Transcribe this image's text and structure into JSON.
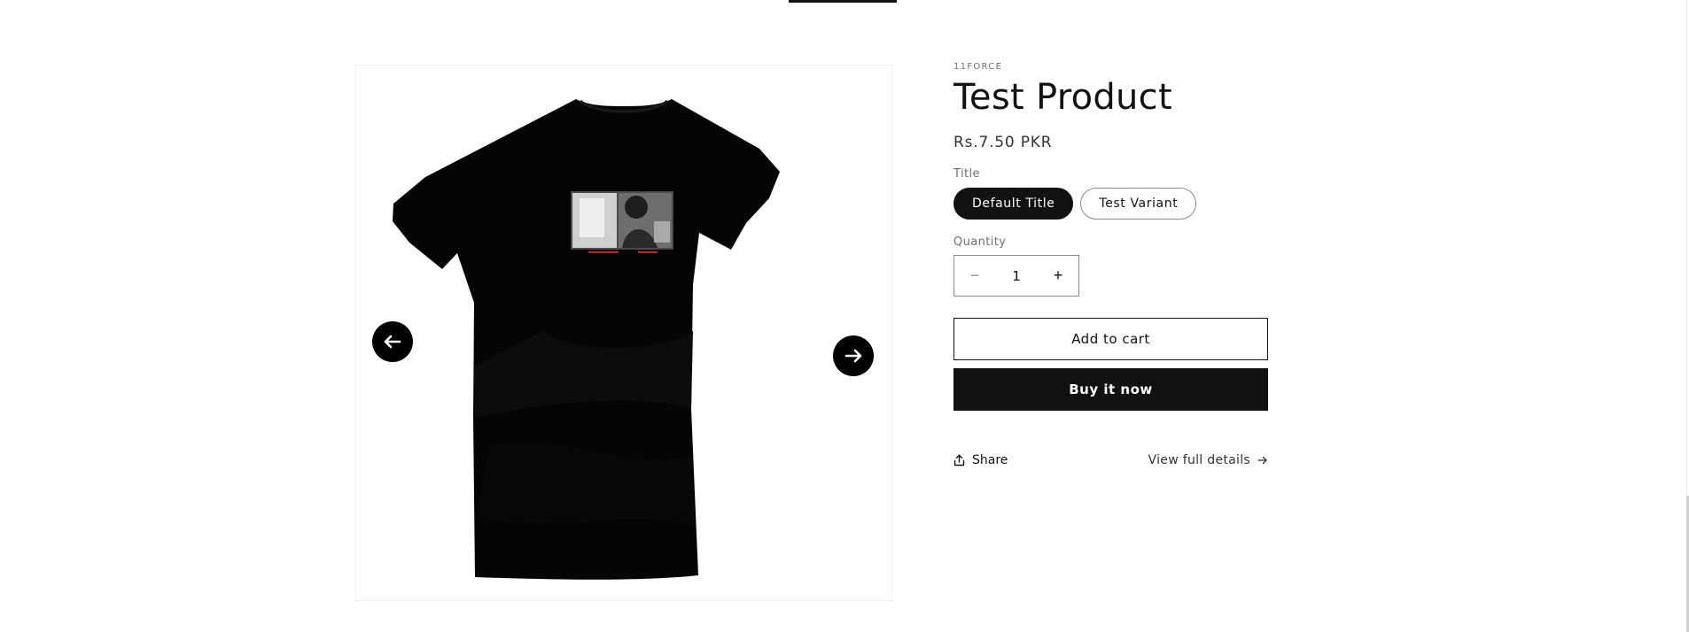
{
  "product": {
    "vendor": "11FORCE",
    "title": "Test Product",
    "price": "Rs.7.50 PKR",
    "image": {
      "icon": "black-tshirt-image"
    }
  },
  "gallery": {
    "prev_icon": "arrow-left-icon",
    "next_icon": "arrow-right-icon"
  },
  "options": {
    "label": "Title",
    "values": [
      "Default Title",
      "Test Variant"
    ],
    "selected": "Default Title"
  },
  "quantity": {
    "label": "Quantity",
    "value": "1",
    "minus": "−",
    "plus": "+"
  },
  "buttons": {
    "add_to_cart": "Add to cart",
    "buy_now": "Buy it now"
  },
  "links": {
    "share": "Share",
    "view_details": "View full details"
  },
  "colors": {
    "accent": "#121212",
    "background": "#ffffff"
  }
}
